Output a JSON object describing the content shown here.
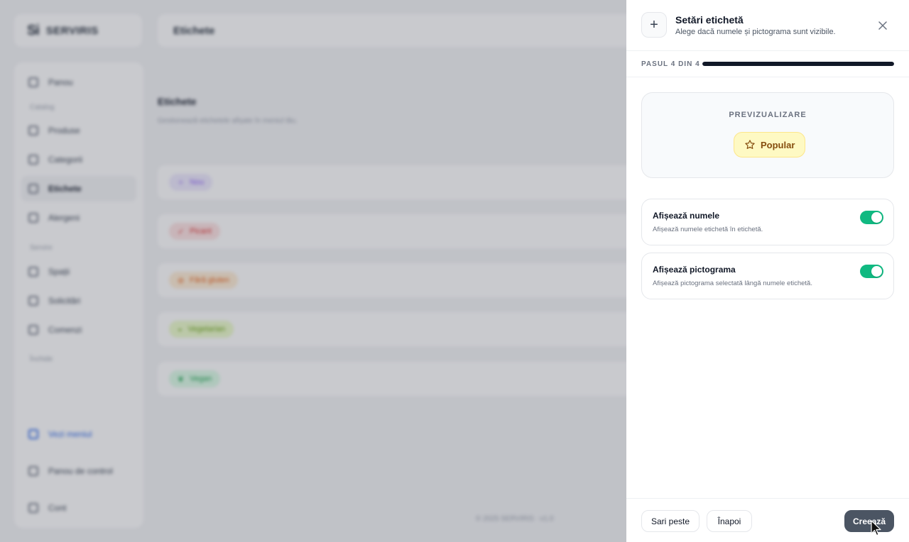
{
  "background": {
    "logo_mark": "Si",
    "logo_text": "SERVIRIS",
    "page_title": "Etichete",
    "sidebar": {
      "items": [
        {
          "label": "Panou",
          "icon": "grid-icon"
        },
        {
          "label": "Produse",
          "icon": "box-icon"
        },
        {
          "label": "Categorii",
          "icon": "layers-icon"
        },
        {
          "label": "Etichete",
          "icon": "tag-icon"
        },
        {
          "label": "Alergeni",
          "icon": "leaf-icon"
        },
        {
          "label": "Spații",
          "icon": "location-icon"
        },
        {
          "label": "Solicitări",
          "icon": "bell-icon"
        },
        {
          "label": "Comenzi",
          "icon": "receipt-icon"
        }
      ],
      "section_catalog": "Catalog",
      "section_service": "Servire",
      "section_more": "Închide",
      "links": [
        {
          "label": "Vezi meniul",
          "icon": "external-link-icon"
        },
        {
          "label": "Panou de control",
          "icon": "dashboard-icon"
        },
        {
          "label": "Cont",
          "icon": "user-icon"
        }
      ]
    },
    "main_title": "Etichete",
    "main_subtitle": "Gestionează etichetele afișate în meniul tău.",
    "tags": [
      {
        "label": "Nou",
        "color": "#8b5cf6",
        "bg": "#ede9fe"
      },
      {
        "label": "Picant",
        "color": "#dc2626",
        "bg": "#fee2e2"
      },
      {
        "label": "Fără gluten",
        "color": "#ea580c",
        "bg": "#ffedd5"
      },
      {
        "label": "Vegetarian",
        "color": "#65a30d",
        "bg": "#ecfccb"
      },
      {
        "label": "Vegan",
        "color": "#16a34a",
        "bg": "#dcfce7"
      }
    ],
    "footer_text": "© 2025 SERVIRIS · v1.0"
  },
  "drawer": {
    "title": "Setări etichetă",
    "subtitle": "Alege dacă numele și pictograma sunt vizibile.",
    "step_label": "PASUL 4 DIN 4",
    "progress": 1.0,
    "preview": {
      "label": "PREVIZUALIZARE",
      "chip_label": "Popular",
      "chip_icon": "star-icon"
    },
    "options": [
      {
        "title": "Afișează numele",
        "description": "Afișează numele etichetă în etichetă.",
        "enabled": true
      },
      {
        "title": "Afișează pictograma",
        "description": "Afișează pictograma selectată lângă numele etichetă.",
        "enabled": true
      }
    ],
    "buttons": {
      "skip": "Sari peste",
      "back": "Înapoi",
      "create": "Creează"
    }
  },
  "colors": {
    "accent": "#10b981",
    "brand": "#2563eb",
    "primary_button": "#4b5563"
  }
}
